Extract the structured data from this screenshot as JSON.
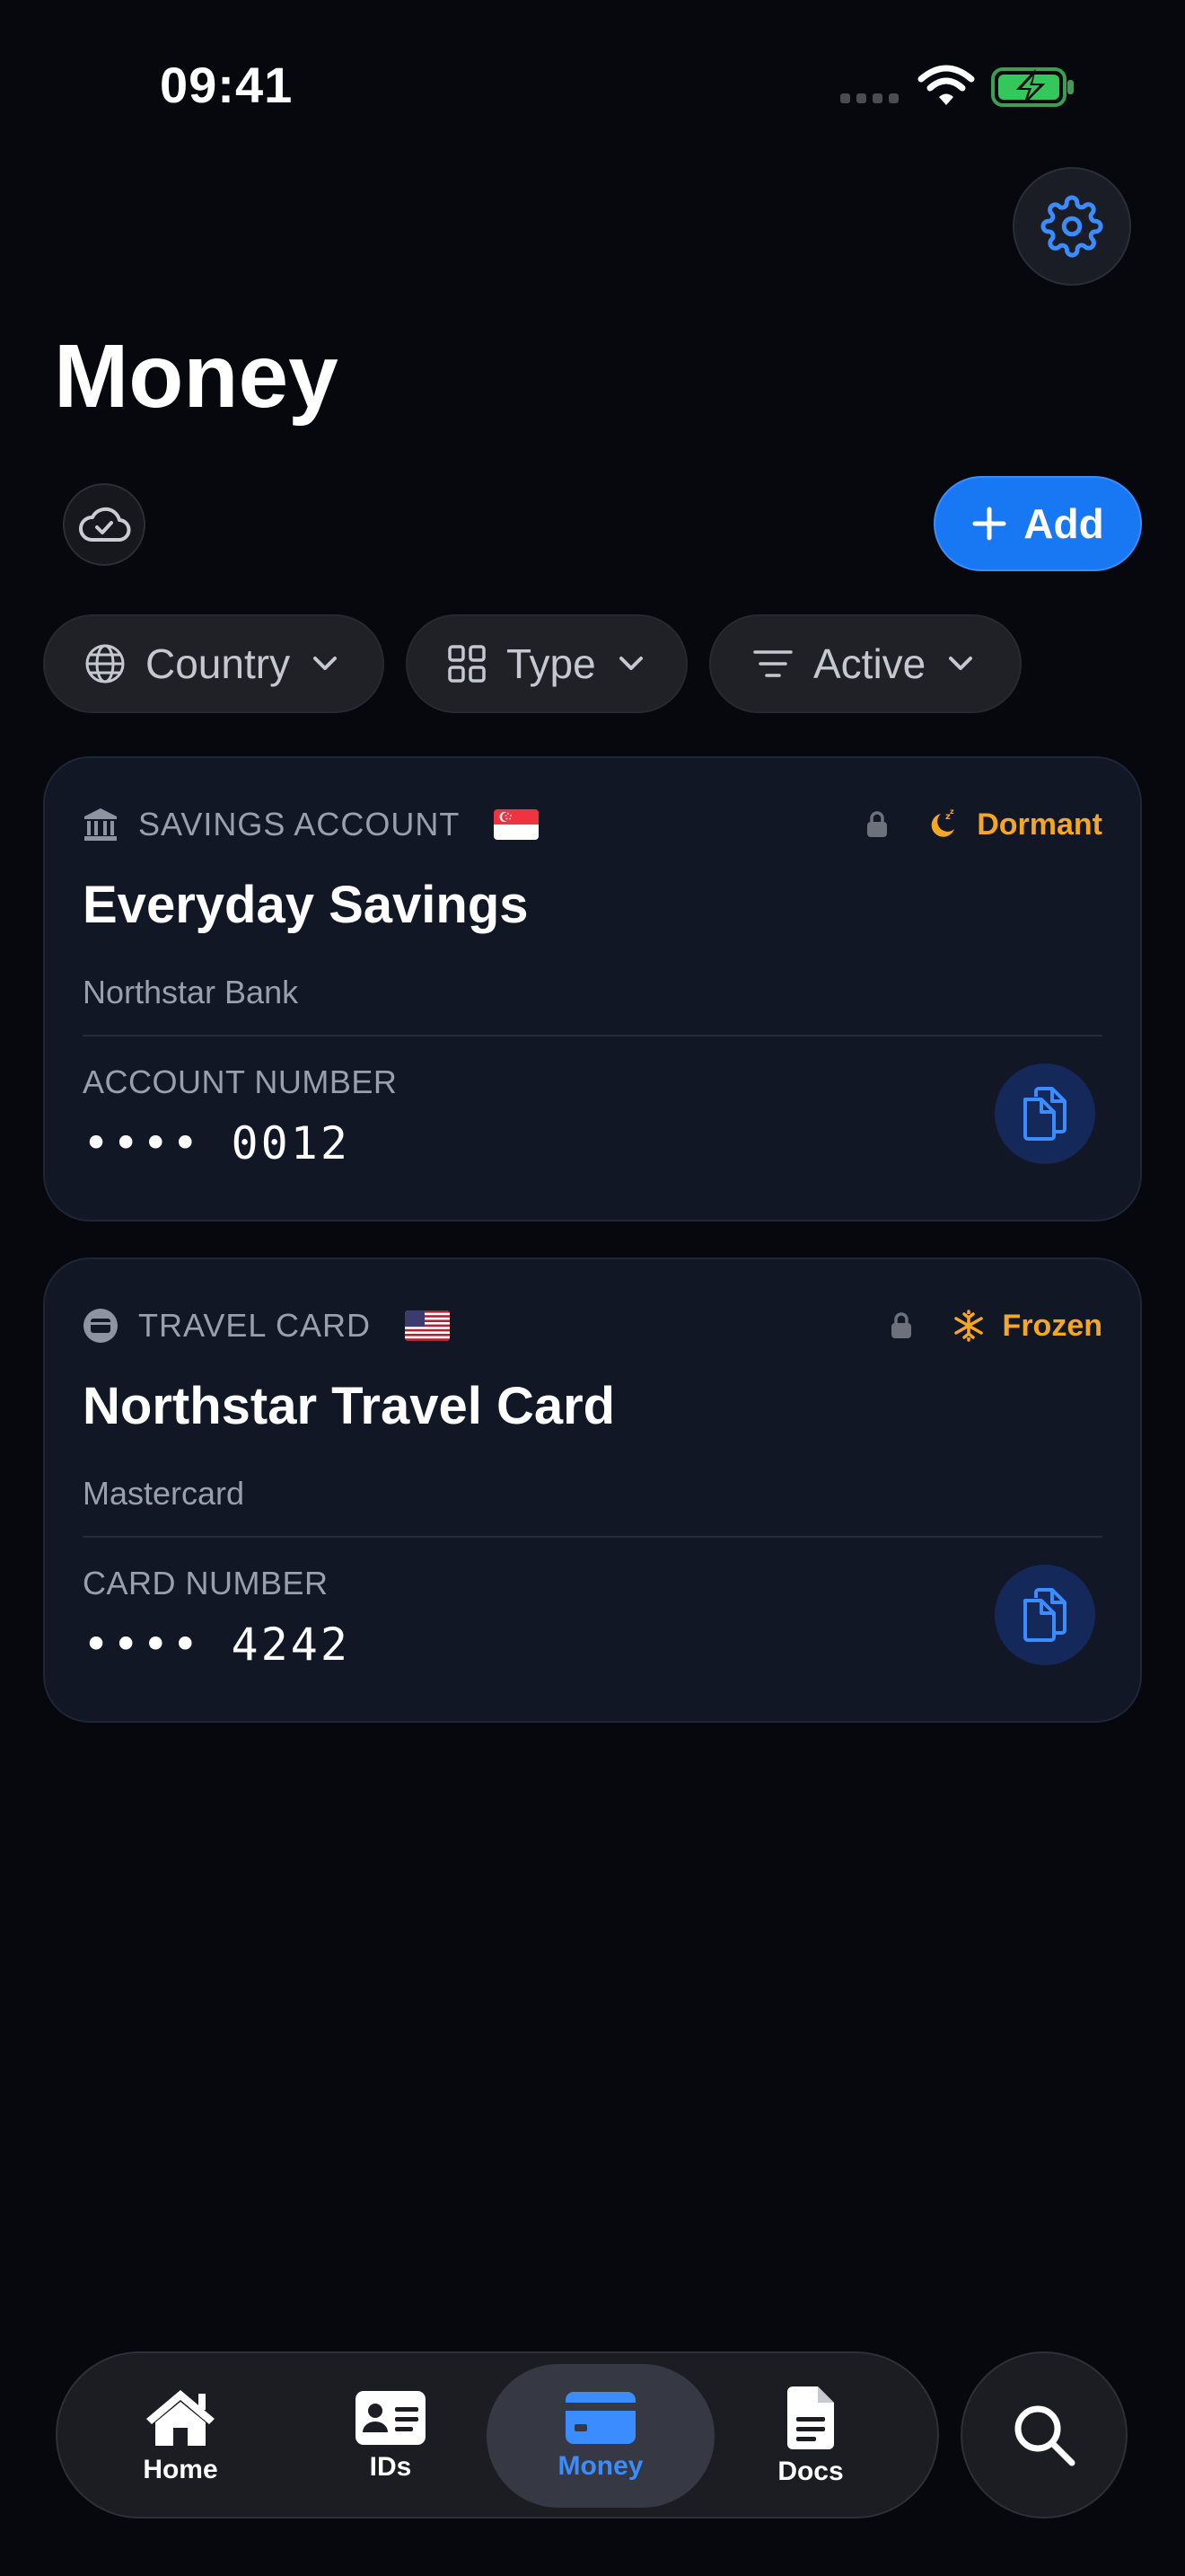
{
  "status_bar": {
    "time": "09:41"
  },
  "header": {
    "title": "Money"
  },
  "toolbar": {
    "add_label": "Add"
  },
  "filters": [
    {
      "label": "Country",
      "icon": "globe-icon"
    },
    {
      "label": "Type",
      "icon": "grid-icon"
    },
    {
      "label": "Active",
      "icon": "filter-lines-icon"
    }
  ],
  "cards": [
    {
      "type_label": "SAVINGS ACCOUNT",
      "type_icon": "bank-icon",
      "flag": "singapore",
      "status": "Dormant",
      "status_icon": "moon-sleep-icon",
      "title": "Everyday Savings",
      "subtitle": "Northstar Bank",
      "number_label": "ACCOUNT NUMBER",
      "number_value": "•••• 0012"
    },
    {
      "type_label": "TRAVEL CARD",
      "type_icon": "card-icon",
      "flag": "united-states",
      "status": "Frozen",
      "status_icon": "snowflake-icon",
      "title": "Northstar Travel Card",
      "subtitle": "Mastercard",
      "number_label": "CARD NUMBER",
      "number_value": "•••• 4242"
    }
  ],
  "tabs": [
    {
      "label": "Home",
      "icon": "house-icon"
    },
    {
      "label": "IDs",
      "icon": "id-card-icon"
    },
    {
      "label": "Money",
      "icon": "credit-card-icon",
      "active": true
    },
    {
      "label": "Docs",
      "icon": "document-icon"
    }
  ],
  "colors": {
    "accent": "#1877f2",
    "active_tab": "#3b8cff",
    "warning": "#f5a623",
    "background": "#07080d",
    "card": "#111725"
  }
}
